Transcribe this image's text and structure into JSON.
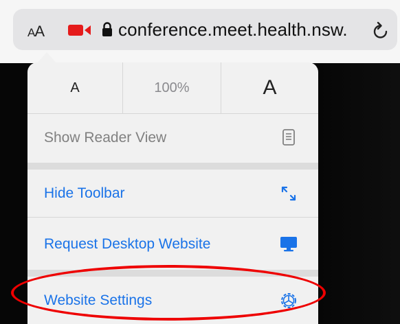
{
  "browser": {
    "text_size_button": {
      "small": "A",
      "large": "A"
    },
    "url": "conference.meet.health.nsw.",
    "icons": {
      "camera": "video-camera-icon",
      "lock": "lock-icon",
      "reload": "reload-icon"
    },
    "accent_color": "#1a73e8"
  },
  "menu": {
    "font_small": "A",
    "zoom": "100%",
    "font_large": "A",
    "items": [
      {
        "label": "Show Reader View",
        "icon": "reader-view-icon",
        "enabled": false
      },
      {
        "label": "Hide Toolbar",
        "icon": "resize-arrows-icon",
        "enabled": true
      },
      {
        "label": "Request Desktop Website",
        "icon": "desktop-monitor-icon",
        "enabled": true
      },
      {
        "label": "Website Settings",
        "icon": "gear-icon",
        "enabled": true
      }
    ]
  },
  "annotation": {
    "color": "#e00000",
    "target": "Website Settings"
  }
}
